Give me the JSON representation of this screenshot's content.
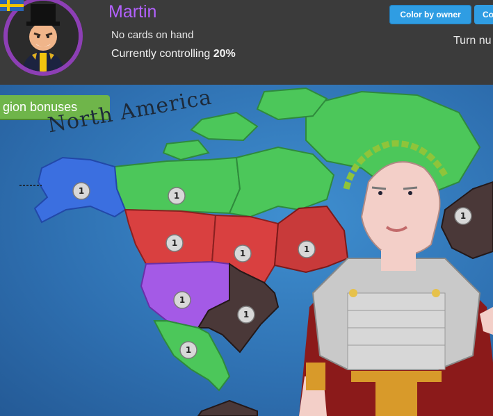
{
  "player": {
    "name": "Martin",
    "cards_text": "No cards on hand",
    "controlling_prefix": "Currently controlling",
    "controlling_value": "20%"
  },
  "buttons": {
    "color_by_owner": "Color by owner",
    "second_button": "Co"
  },
  "turn_text": "Turn nu",
  "map": {
    "region_bonuses_label": "gion bonuses",
    "continent_label": "North America",
    "territories": [
      {
        "name": "alaska",
        "owner_color": "#3b6fe0",
        "troops": "1"
      },
      {
        "name": "northwest-territory",
        "owner_color": "#4cc75a",
        "troops": "1"
      },
      {
        "name": "alberta",
        "owner_color": "#d94040",
        "troops": "1"
      },
      {
        "name": "ontario",
        "owner_color": "#d94040",
        "troops": "1"
      },
      {
        "name": "quebec",
        "owner_color": "#c83a3a",
        "troops": "1"
      },
      {
        "name": "western-united-states",
        "owner_color": "#a45ae6",
        "troops": "1"
      },
      {
        "name": "eastern-united-states",
        "owner_color": "#4a3838",
        "troops": "1"
      },
      {
        "name": "central-america",
        "owner_color": "#4cc75a",
        "troops": "1"
      },
      {
        "name": "iceland",
        "owner_color": "#4a3838",
        "troops": "1"
      }
    ]
  },
  "colors": {
    "accent_blue": "#2f9de3",
    "player_purple": "#b361ff",
    "region_green": "#6fb54a"
  }
}
